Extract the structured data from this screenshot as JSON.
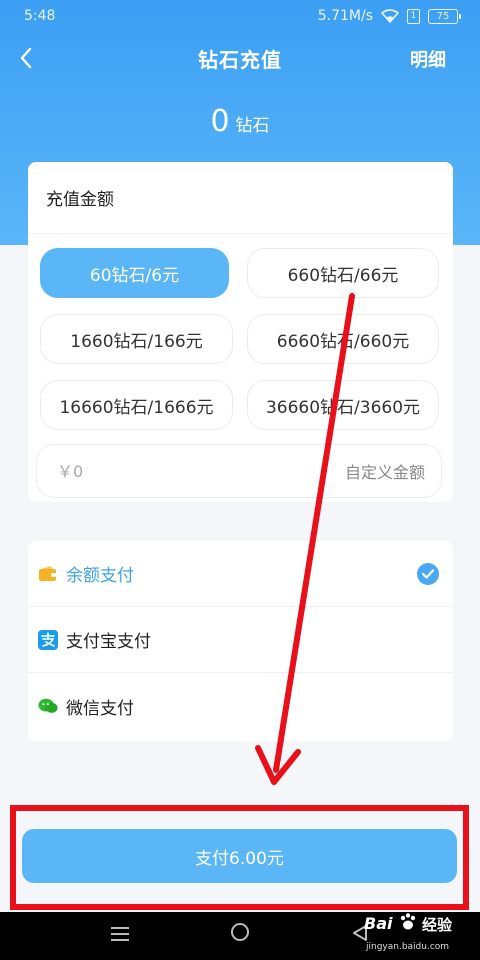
{
  "status_bar": {
    "time": "5:48",
    "speed": "5.71M/s",
    "sim": "1",
    "battery": "75"
  },
  "nav": {
    "title": "钻石充值",
    "detail_label": "明细"
  },
  "balance": {
    "value": "0",
    "unit": "钻石"
  },
  "recharge": {
    "title": "充值金额",
    "options": [
      {
        "label": "60钻石/6元",
        "selected": true
      },
      {
        "label": "660钻石/66元",
        "selected": false
      },
      {
        "label": "1660钻石/166元",
        "selected": false
      },
      {
        "label": "6660钻石/660元",
        "selected": false
      },
      {
        "label": "16660钻石/1666元",
        "selected": false
      },
      {
        "label": "36660钻石/3660元",
        "selected": false
      }
    ],
    "custom_placeholder": "￥0",
    "custom_label": "自定义金额"
  },
  "payment": {
    "methods": [
      {
        "label": "余额支付",
        "icon": "wallet-icon",
        "active": true
      },
      {
        "label": "支付宝支付",
        "icon": "alipay-icon",
        "active": false
      },
      {
        "label": "微信支付",
        "icon": "wechat-icon",
        "active": false
      }
    ]
  },
  "pay_button": {
    "label": "支付6.00元"
  },
  "watermark": {
    "brand": "Bai",
    "sub": "经验",
    "url": "jingyan.baidu.com"
  },
  "colors": {
    "primary": "#5ab6f7",
    "header_top": "#3c9ff4",
    "annotation_red": "#e8101b"
  }
}
